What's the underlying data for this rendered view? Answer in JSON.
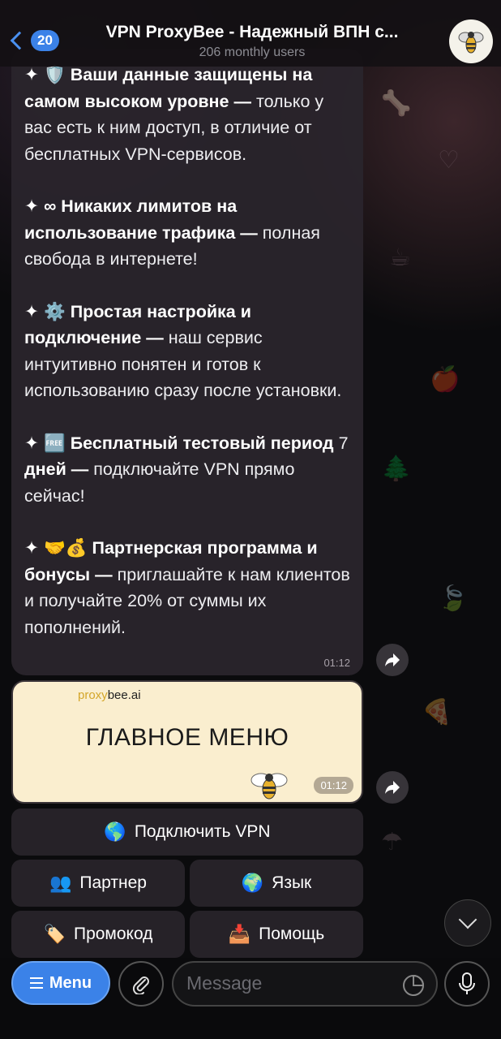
{
  "header": {
    "back_count": "20",
    "title": "VPN ProxyBee - Надежный ВПН с...",
    "subtitle": "206 monthly users"
  },
  "message": {
    "p1_bold": "✦ 🛡️ Ваши данные защищены на самом высоком уровне —",
    "p1_text": " только у вас есть к ним доступ, в отличие от бесплатных VPN-сервисов.",
    "p2_bold": "✦ ∞ Никаких лимитов на использование трафика —",
    "p2_text": " полная свобода в интернете!",
    "p3_bold": "✦ ⚙️ Простая настройка и подключение —",
    "p3_text": " наш сервис интуитивно понятен и готов к использованию сразу после установки.",
    "p4_bold_a": "✦ 🆓 Бесплатный тестовый период",
    "p4_num": " 7 ",
    "p4_bold_b": "дней —",
    "p4_text": " подключайте VPN прямо сейчас!",
    "p5_bold": "✦ 🤝💰 Партнерская программа и бонусы —",
    "p5_text": " приглашайте к нам клиентов и получайте 20% от суммы их пополнений.",
    "time": "01:12"
  },
  "image_message": {
    "brand_a": "proxy",
    "brand_b": "bee.ai",
    "heading": "ГЛАВНОЕ МЕНЮ",
    "time": "01:12"
  },
  "keyboard": {
    "connect": {
      "icon": "🌎",
      "label": "Подключить VPN"
    },
    "partner": {
      "icon": "👥",
      "label": "Партнер"
    },
    "language": {
      "icon": "🌍",
      "label": "Язык"
    },
    "promo": {
      "icon": "🏷️",
      "label": "Промокод"
    },
    "help": {
      "icon": "📥",
      "label": "Помощь"
    }
  },
  "composer": {
    "menu_label": "Menu",
    "placeholder": "Message"
  },
  "colors": {
    "accent": "#3b82e8",
    "bubble": "#2a242c",
    "image_bg": "#faeecf"
  }
}
